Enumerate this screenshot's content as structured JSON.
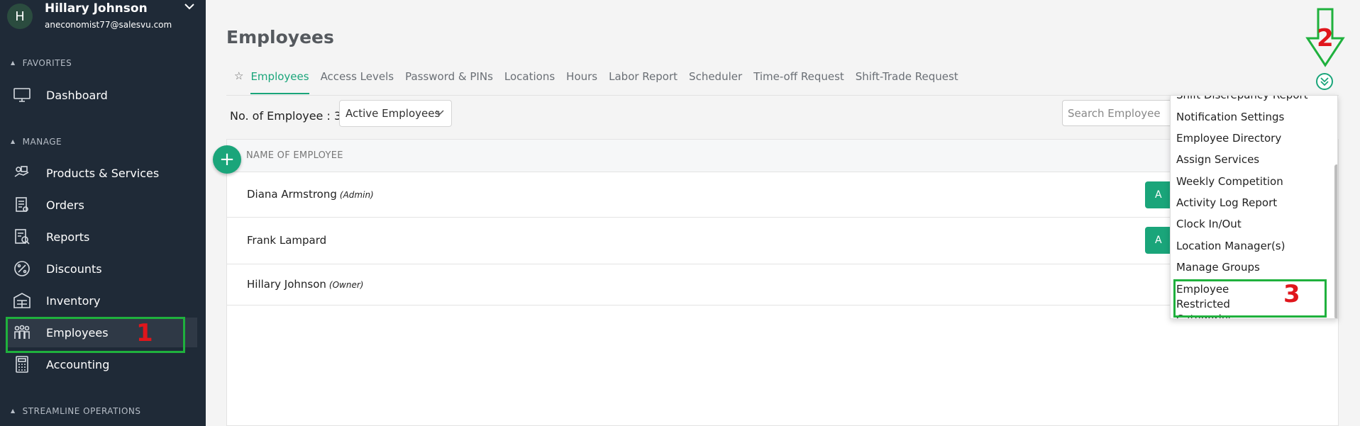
{
  "user": {
    "initial": "H",
    "name": "Hillary Johnson",
    "email": "aneconomist77@salesvu.com"
  },
  "sidebar": {
    "favorites_title": "FAVORITES",
    "manage_title": "MANAGE",
    "streamline_title": "STREAMLINE OPERATIONS",
    "items": [
      {
        "label": "Dashboard",
        "icon": "monitor-icon"
      },
      {
        "label": "Products & Services",
        "icon": "products-icon"
      },
      {
        "label": "Orders",
        "icon": "orders-icon"
      },
      {
        "label": "Reports",
        "icon": "reports-icon"
      },
      {
        "label": "Discounts",
        "icon": "percent-icon"
      },
      {
        "label": "Inventory",
        "icon": "inventory-icon"
      },
      {
        "label": "Employees",
        "icon": "people-icon"
      },
      {
        "label": "Accounting",
        "icon": "calculator-icon"
      }
    ]
  },
  "page": {
    "title": "Employees"
  },
  "tabs": [
    "Employees",
    "Access Levels",
    "Password & PINs",
    "Locations",
    "Hours",
    "Labor Report",
    "Scheduler",
    "Time-off Request",
    "Shift-Trade Request"
  ],
  "toolbar": {
    "count_label": "No. of Employee : 3",
    "filter_value": "Active Employees",
    "search_placeholder": "Search Employee"
  },
  "table": {
    "header_name": "NAME OF EMPLOYEE",
    "rows": [
      {
        "name": "Diana Armstrong",
        "role": "(Admin)",
        "action": "A"
      },
      {
        "name": "Frank Lampard",
        "role": "",
        "action": "A"
      },
      {
        "name": "Hillary Johnson",
        "role": "(Owner)",
        "action": ""
      }
    ]
  },
  "dropdown": {
    "items": [
      "Shift Discrepancy Report",
      "Notification Settings",
      "Employee Directory",
      "Assign Services",
      "Weekly Competition",
      "Activity Log Report",
      "Clock In/Out",
      "Location Manager(s)",
      "Manage Groups",
      "Employee Restricted Categories"
    ]
  },
  "annotations": {
    "step1": "1",
    "step2": "2",
    "step3": "3",
    "color_highlight": "#1fb13d",
    "color_number": "#e0161c"
  },
  "colors": {
    "accent": "#1aa57a",
    "sidebar_bg": "#1f2a37"
  }
}
